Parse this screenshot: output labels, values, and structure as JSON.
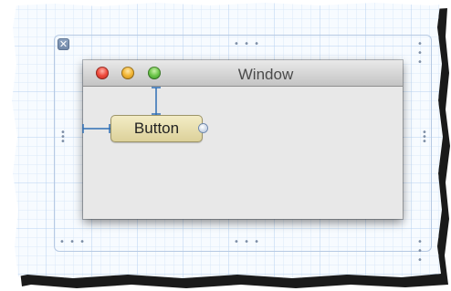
{
  "window": {
    "title": "Window"
  },
  "button": {
    "label": "Button"
  },
  "frame": {
    "close_glyph": "✕",
    "resize_dots": "• • •",
    "resize_dots_vertical": "•\n•\n•"
  },
  "colors": {
    "grid_major": "#a9c8ee",
    "grid_minor": "#dbe8f8",
    "constraint": "#2f6fb5",
    "button_fill": "#e8dfae"
  },
  "icons": {
    "close": "close-icon",
    "traffic_lights": [
      "close-window-icon",
      "minimize-window-icon",
      "zoom-window-icon"
    ],
    "connector": "outlet-connector-icon"
  }
}
